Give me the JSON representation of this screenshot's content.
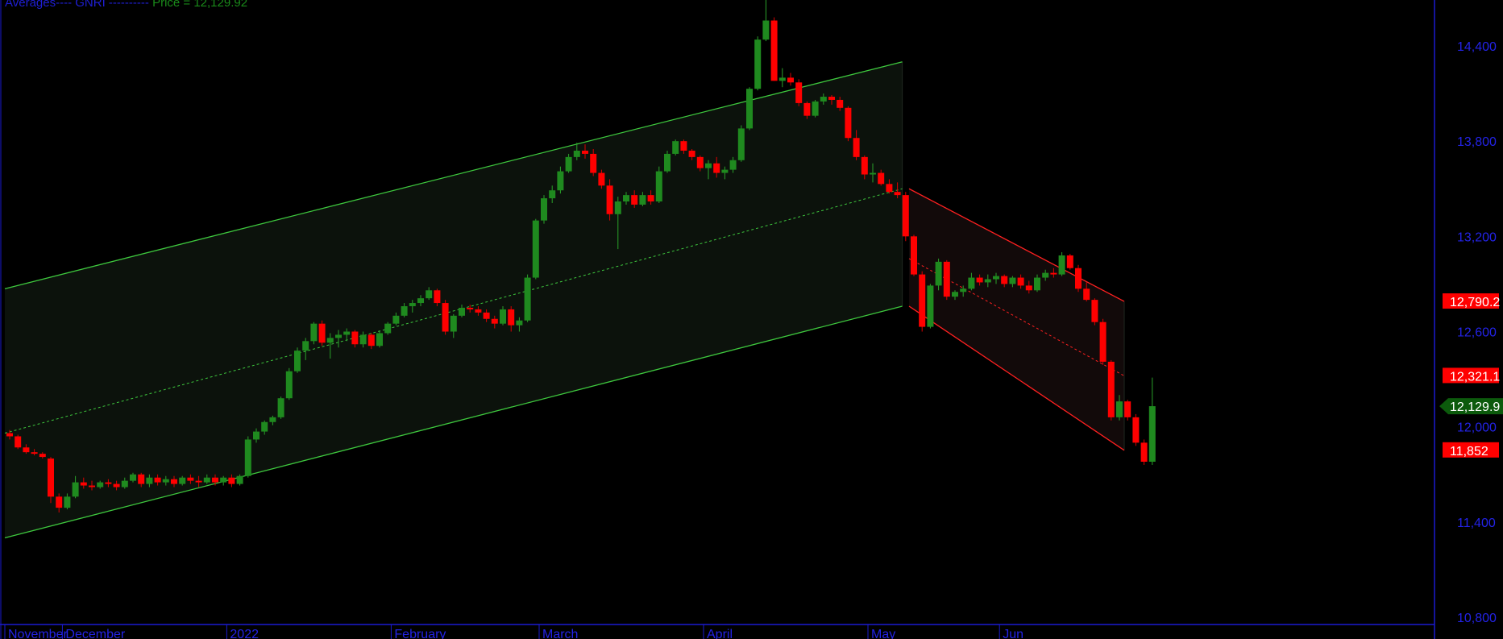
{
  "header": {
    "averages_label": "Averages----",
    "gnri_label": "GNRI ----------",
    "price_label": "Price = 12,129.92"
  },
  "colors": {
    "background": "#000000",
    "axis": "#1a1ad0",
    "axis_text": "#2323e6",
    "up_candle": "#1f8a1f",
    "down_candle": "#ff0000",
    "green_channel": "#3ec83e",
    "red_channel": "#ff2020",
    "green_fill": "#0c120c",
    "red_fill": "#120a0a"
  },
  "chart_data": {
    "type": "candlestick",
    "title": "",
    "ylim": [
      10800,
      14700
    ],
    "y_ticks": [
      {
        "value": 14400,
        "label": "14,400"
      },
      {
        "value": 13800,
        "label": "13,800"
      },
      {
        "value": 13200,
        "label": "13,200"
      },
      {
        "value": 12600,
        "label": "12,600"
      },
      {
        "value": 12000,
        "label": "12,000"
      },
      {
        "value": 11400,
        "label": "11,400"
      },
      {
        "value": 10800,
        "label": "10,800"
      }
    ],
    "x_months": [
      {
        "label": "November",
        "index": 0
      },
      {
        "label": "December",
        "index": 7
      },
      {
        "label": "2022",
        "index": 27
      },
      {
        "label": "February",
        "index": 47
      },
      {
        "label": "March",
        "index": 65
      },
      {
        "label": "April",
        "index": 85
      },
      {
        "label": "May",
        "index": 105
      },
      {
        "label": "Jun",
        "index": 121
      }
    ],
    "price_labels": [
      {
        "value": 12790.2,
        "label": "12,790.2",
        "style": "red"
      },
      {
        "value": 12321.1,
        "label": "12,321.1",
        "style": "red"
      },
      {
        "value": 12129.92,
        "label": "12,129.9",
        "style": "green-arrow"
      },
      {
        "value": 11852,
        "label": "11,852",
        "style": "red"
      }
    ],
    "channels": [
      {
        "name": "",
        "color": "green",
        "x_index": [
          0,
          108
        ],
        "upper": [
          12870,
          14300
        ],
        "mid": [
          11960,
          13500
        ],
        "lower": [
          11300,
          12760
        ]
      },
      {
        "name": "",
        "color": "red",
        "x_index": [
          110,
          135
        ],
        "upper": [
          13500,
          12790
        ],
        "mid": [
          13060,
          12321
        ],
        "lower": [
          12760,
          11852
        ]
      }
    ],
    "ohlc": [
      [
        11960,
        11980,
        11920,
        11940
      ],
      [
        11940,
        11950,
        11860,
        11870
      ],
      [
        11870,
        11890,
        11830,
        11840
      ],
      [
        11840,
        11860,
        11820,
        11830
      ],
      [
        11830,
        11840,
        11800,
        11810
      ],
      [
        11800,
        11810,
        11520,
        11560
      ],
      [
        11560,
        11580,
        11460,
        11490
      ],
      [
        11490,
        11580,
        11480,
        11560
      ],
      [
        11560,
        11690,
        11550,
        11650
      ],
      [
        11650,
        11680,
        11610,
        11630
      ],
      [
        11630,
        11660,
        11600,
        11620
      ],
      [
        11620,
        11660,
        11610,
        11650
      ],
      [
        11650,
        11670,
        11620,
        11640
      ],
      [
        11640,
        11660,
        11600,
        11620
      ],
      [
        11620,
        11680,
        11610,
        11660
      ],
      [
        11660,
        11710,
        11650,
        11700
      ],
      [
        11700,
        11710,
        11620,
        11640
      ],
      [
        11640,
        11700,
        11620,
        11680
      ],
      [
        11680,
        11700,
        11630,
        11650
      ],
      [
        11650,
        11690,
        11630,
        11670
      ],
      [
        11670,
        11690,
        11620,
        11640
      ],
      [
        11640,
        11690,
        11630,
        11680
      ],
      [
        11680,
        11700,
        11640,
        11660
      ],
      [
        11660,
        11690,
        11620,
        11650
      ],
      [
        11650,
        11700,
        11640,
        11680
      ],
      [
        11680,
        11700,
        11630,
        11650
      ],
      [
        11650,
        11690,
        11630,
        11680
      ],
      [
        11680,
        11700,
        11620,
        11640
      ],
      [
        11640,
        11700,
        11630,
        11690
      ],
      [
        11690,
        11940,
        11680,
        11920
      ],
      [
        11920,
        11990,
        11900,
        11970
      ],
      [
        11970,
        12040,
        11950,
        12030
      ],
      [
        12030,
        12070,
        12010,
        12060
      ],
      [
        12060,
        12190,
        12050,
        12180
      ],
      [
        12180,
        12370,
        12170,
        12350
      ],
      [
        12350,
        12500,
        12340,
        12480
      ],
      [
        12480,
        12560,
        12420,
        12540
      ],
      [
        12540,
        12660,
        12520,
        12650
      ],
      [
        12650,
        12670,
        12510,
        12530
      ],
      [
        12530,
        12590,
        12430,
        12560
      ],
      [
        12560,
        12610,
        12500,
        12580
      ],
      [
        12580,
        12620,
        12540,
        12600
      ],
      [
        12600,
        12610,
        12500,
        12520
      ],
      [
        12520,
        12600,
        12500,
        12580
      ],
      [
        12580,
        12590,
        12490,
        12510
      ],
      [
        12510,
        12600,
        12500,
        12590
      ],
      [
        12590,
        12660,
        12580,
        12650
      ],
      [
        12650,
        12720,
        12640,
        12700
      ],
      [
        12700,
        12780,
        12690,
        12760
      ],
      [
        12760,
        12800,
        12720,
        12780
      ],
      [
        12780,
        12830,
        12760,
        12810
      ],
      [
        12810,
        12880,
        12800,
        12860
      ],
      [
        12860,
        12870,
        12760,
        12780
      ],
      [
        12780,
        12800,
        12580,
        12600
      ],
      [
        12600,
        12710,
        12560,
        12700
      ],
      [
        12700,
        12770,
        12690,
        12750
      ],
      [
        12750,
        12770,
        12720,
        12740
      ],
      [
        12740,
        12760,
        12700,
        12720
      ],
      [
        12720,
        12740,
        12660,
        12680
      ],
      [
        12680,
        12700,
        12620,
        12650
      ],
      [
        12650,
        12760,
        12640,
        12740
      ],
      [
        12740,
        12760,
        12600,
        12640
      ],
      [
        12640,
        12690,
        12600,
        12670
      ],
      [
        12670,
        12960,
        12660,
        12940
      ],
      [
        12940,
        13310,
        12930,
        13300
      ],
      [
        13300,
        13460,
        13280,
        13440
      ],
      [
        13440,
        13520,
        13410,
        13490
      ],
      [
        13490,
        13640,
        13470,
        13610
      ],
      [
        13610,
        13720,
        13600,
        13700
      ],
      [
        13700,
        13790,
        13680,
        13740
      ],
      [
        13740,
        13780,
        13690,
        13720
      ],
      [
        13720,
        13750,
        13580,
        13600
      ],
      [
        13600,
        13620,
        13500,
        13520
      ],
      [
        13520,
        13560,
        13300,
        13340
      ],
      [
        13340,
        13450,
        13120,
        13420
      ],
      [
        13420,
        13480,
        13400,
        13460
      ],
      [
        13460,
        13490,
        13380,
        13400
      ],
      [
        13400,
        13480,
        13390,
        13460
      ],
      [
        13460,
        13490,
        13400,
        13420
      ],
      [
        13420,
        13640,
        13410,
        13610
      ],
      [
        13610,
        13740,
        13600,
        13720
      ],
      [
        13720,
        13810,
        13710,
        13800
      ],
      [
        13800,
        13810,
        13720,
        13740
      ],
      [
        13740,
        13750,
        13680,
        13700
      ],
      [
        13700,
        13710,
        13610,
        13630
      ],
      [
        13630,
        13680,
        13560,
        13660
      ],
      [
        13660,
        13700,
        13570,
        13600
      ],
      [
        13600,
        13640,
        13560,
        13620
      ],
      [
        13620,
        13700,
        13600,
        13680
      ],
      [
        13680,
        13900,
        13670,
        13880
      ],
      [
        13880,
        14140,
        13870,
        14130
      ],
      [
        14130,
        14460,
        14120,
        14440
      ],
      [
        14440,
        14720,
        14430,
        14560
      ],
      [
        14560,
        14580,
        14180,
        14180
      ],
      [
        14180,
        14260,
        14140,
        14200
      ],
      [
        14200,
        14230,
        14150,
        14170
      ],
      [
        14170,
        14190,
        14020,
        14040
      ],
      [
        14040,
        14050,
        13940,
        13960
      ],
      [
        13960,
        14060,
        13950,
        14050
      ],
      [
        14050,
        14100,
        14030,
        14080
      ],
      [
        14080,
        14090,
        14030,
        14060
      ],
      [
        14060,
        14080,
        13990,
        14010
      ],
      [
        14010,
        14020,
        13800,
        13820
      ],
      [
        13820,
        13870,
        13680,
        13700
      ],
      [
        13700,
        13710,
        13560,
        13590
      ],
      [
        13590,
        13660,
        13540,
        13600
      ],
      [
        13600,
        13620,
        13520,
        13530
      ],
      [
        13530,
        13560,
        13470,
        13480
      ],
      [
        13480,
        13540,
        13440,
        13460
      ],
      [
        13460,
        13480,
        13170,
        13200
      ],
      [
        13200,
        13210,
        12950,
        12960
      ],
      [
        12960,
        12980,
        12600,
        12630
      ],
      [
        12630,
        12900,
        12620,
        12890
      ],
      [
        12890,
        13060,
        12860,
        13040
      ],
      [
        13040,
        13050,
        12800,
        12820
      ],
      [
        12820,
        12860,
        12800,
        12850
      ],
      [
        12850,
        12890,
        12820,
        12870
      ],
      [
        12870,
        12970,
        12860,
        12940
      ],
      [
        12940,
        12960,
        12890,
        12910
      ],
      [
        12910,
        12960,
        12880,
        12930
      ],
      [
        12930,
        12970,
        12900,
        12950
      ],
      [
        12950,
        12960,
        12880,
        12900
      ],
      [
        12900,
        12950,
        12880,
        12940
      ],
      [
        12940,
        12960,
        12870,
        12890
      ],
      [
        12890,
        12920,
        12840,
        12860
      ],
      [
        12860,
        12960,
        12850,
        12940
      ],
      [
        12940,
        12990,
        12920,
        12970
      ],
      [
        12970,
        13000,
        12940,
        12960
      ],
      [
        12960,
        13100,
        12950,
        13080
      ],
      [
        13080,
        13090,
        12990,
        13000
      ],
      [
        13000,
        13020,
        12850,
        12870
      ],
      [
        12870,
        12910,
        12790,
        12800
      ],
      [
        12800,
        12810,
        12640,
        12660
      ],
      [
        12660,
        12680,
        12390,
        12410
      ],
      [
        12410,
        12420,
        12040,
        12060
      ],
      [
        12060,
        12200,
        12040,
        12160
      ],
      [
        12160,
        12170,
        12040,
        12060
      ],
      [
        12060,
        12080,
        11880,
        11900
      ],
      [
        11900,
        11920,
        11760,
        11780
      ],
      [
        11780,
        12310,
        11760,
        12129.92
      ]
    ]
  }
}
